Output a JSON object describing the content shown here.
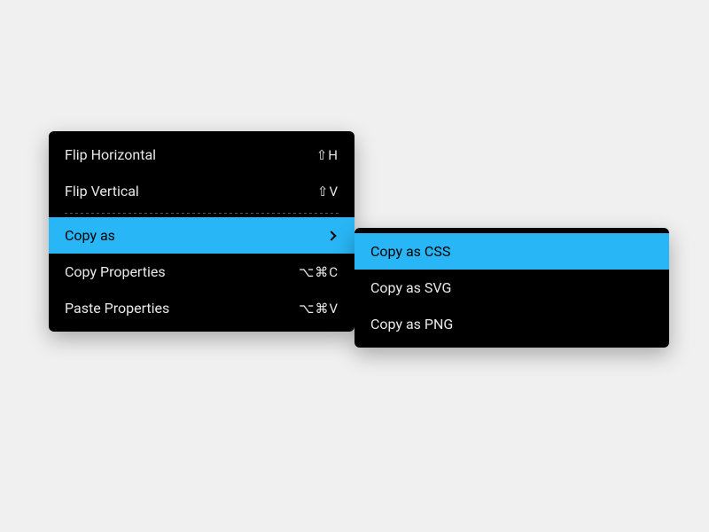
{
  "colors": {
    "highlight": "#29b6f6",
    "menu_bg": "#000000",
    "text": "#e8e8e8"
  },
  "primary_menu": {
    "items": [
      {
        "label": "Flip Horizontal",
        "shortcut": "⇧H"
      },
      {
        "label": "Flip Vertical",
        "shortcut": "⇧V"
      }
    ],
    "items2": [
      {
        "label": "Copy as",
        "has_submenu": true,
        "highlighted": true
      },
      {
        "label": "Copy Properties",
        "shortcut": "⌥⌘C"
      },
      {
        "label": "Paste Properties",
        "shortcut": "⌥⌘V"
      }
    ]
  },
  "submenu": {
    "items": [
      {
        "label": "Copy as CSS",
        "highlighted": true
      },
      {
        "label": "Copy as SVG"
      },
      {
        "label": "Copy as PNG"
      }
    ]
  }
}
